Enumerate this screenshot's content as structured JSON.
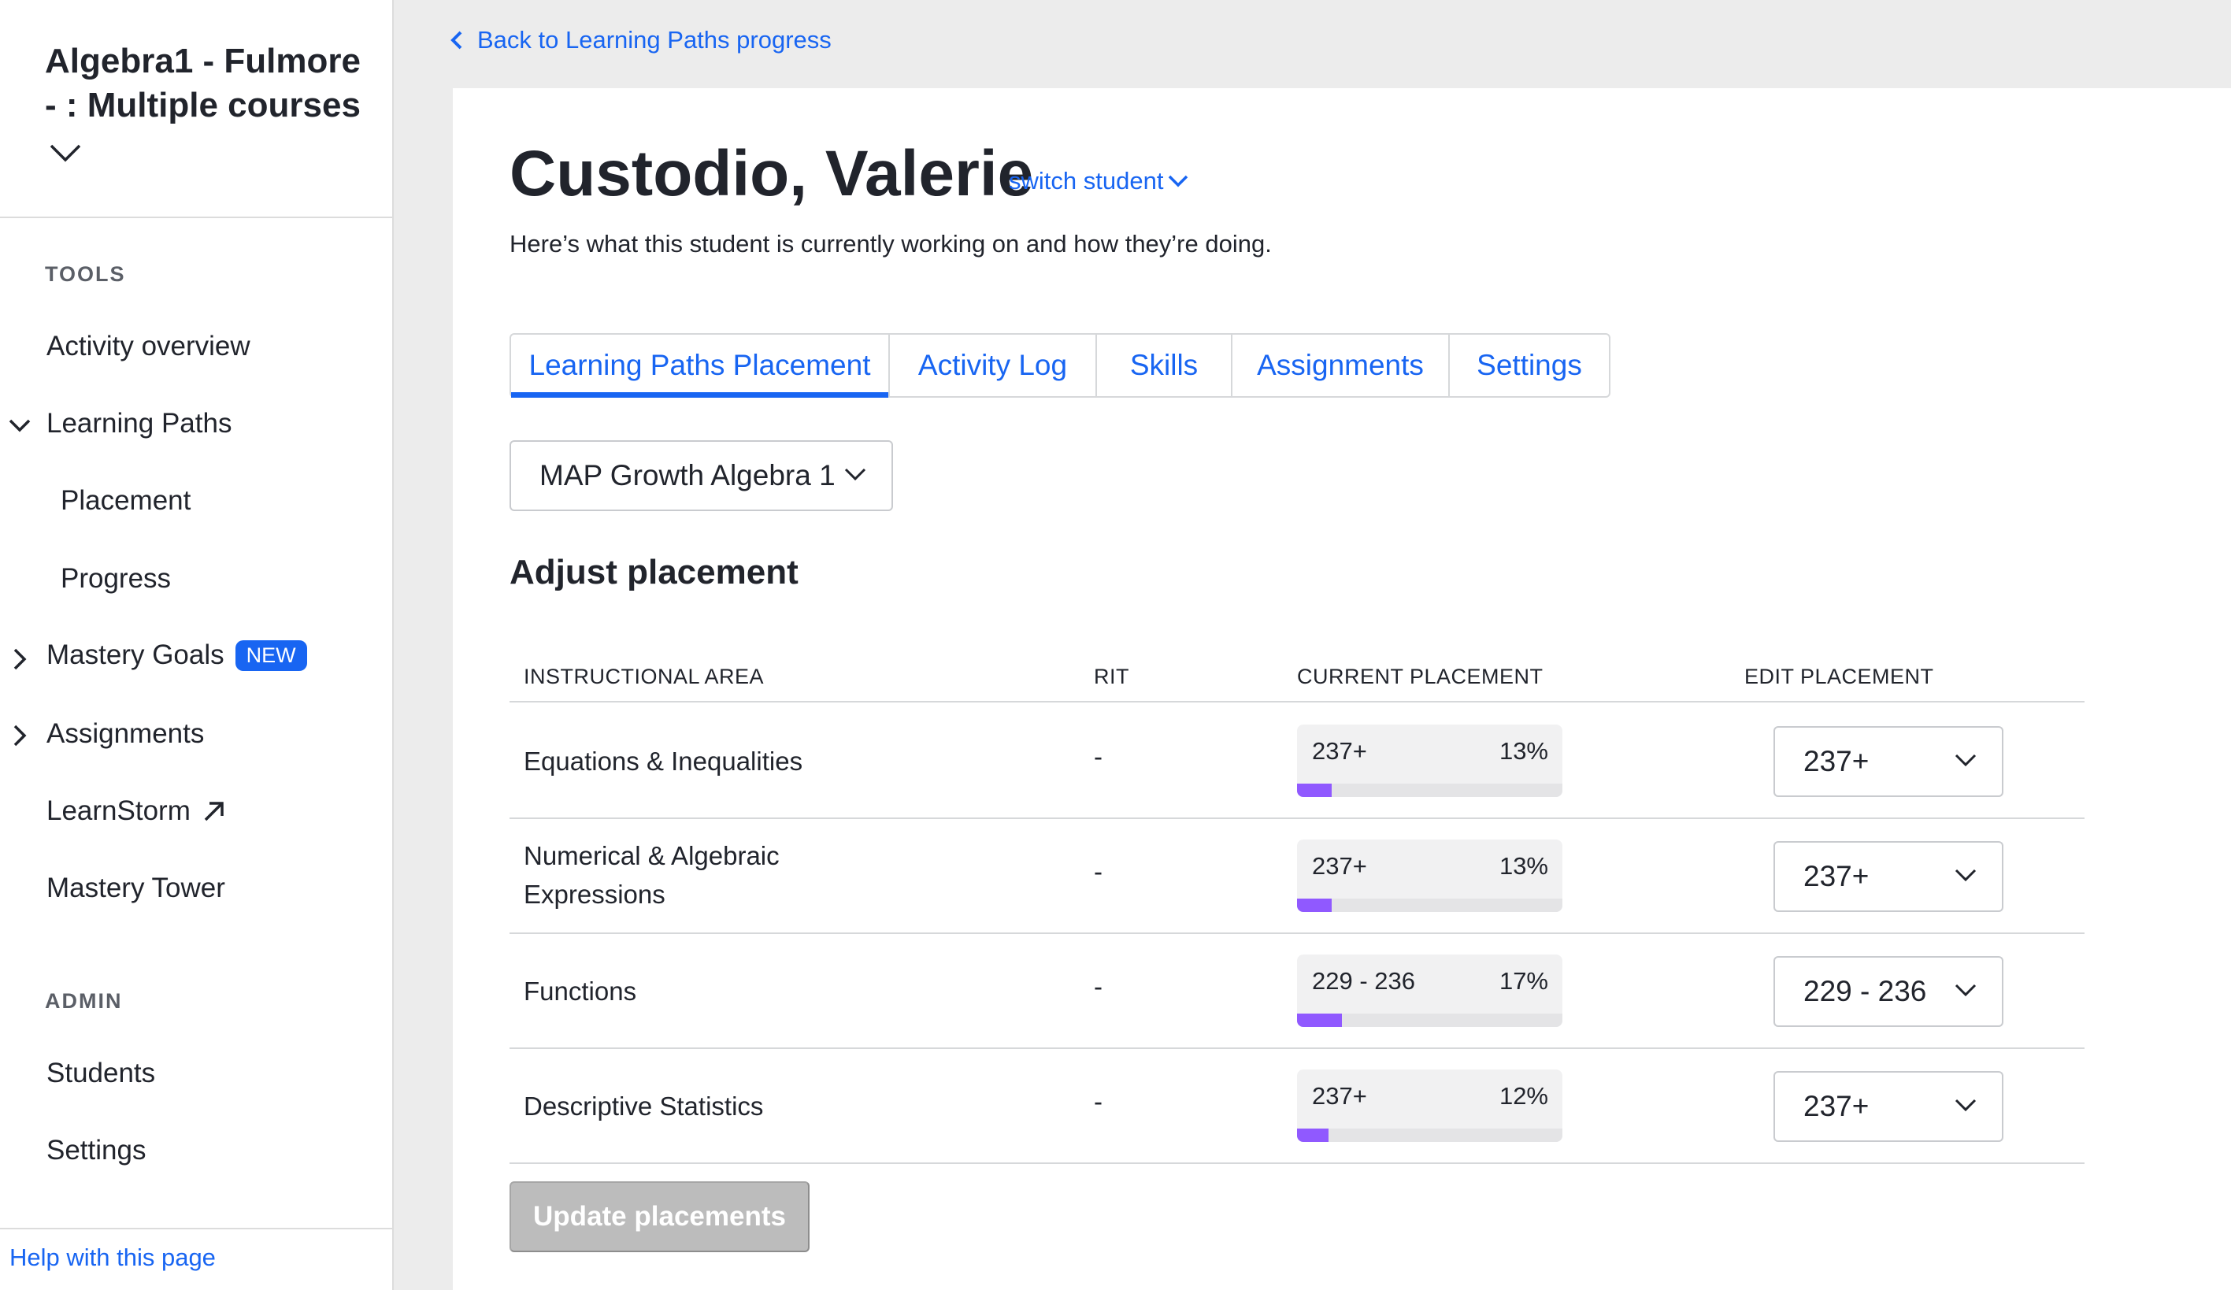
{
  "sidebar": {
    "course_title": "Algebra1 - Fulmore - : Multiple courses",
    "tools_label": "TOOLS",
    "items": [
      {
        "label": "Activity overview"
      },
      {
        "label": "Learning Paths"
      },
      {
        "label": "Placement"
      },
      {
        "label": "Progress"
      },
      {
        "label": "Mastery Goals",
        "badge": "NEW"
      },
      {
        "label": "Assignments"
      },
      {
        "label": "LearnStorm"
      },
      {
        "label": "Mastery Tower"
      }
    ],
    "admin_label": "ADMIN",
    "admin_items": [
      {
        "label": "Students"
      },
      {
        "label": "Settings"
      }
    ],
    "help_link": "Help with this page"
  },
  "back_link": "Back to Learning Paths progress",
  "student": {
    "name": "Custodio, Valerie",
    "switch_label": "switch student",
    "subtitle": "Here’s what this student is currently working on and how they’re doing."
  },
  "tabs": [
    {
      "label": "Learning Paths Placement",
      "active": true
    },
    {
      "label": "Activity Log"
    },
    {
      "label": "Skills"
    },
    {
      "label": "Assignments"
    },
    {
      "label": "Settings"
    }
  ],
  "course_select": {
    "value": "MAP Growth Algebra 1"
  },
  "adjust_heading": "Adjust placement",
  "table": {
    "headers": [
      "INSTRUCTIONAL AREA",
      "RIT",
      "CURRENT PLACEMENT",
      "EDIT PLACEMENT"
    ],
    "rows": [
      {
        "area": "Equations & Inequalities",
        "rit": "-",
        "placement": "237+",
        "percent": "13%",
        "progress": 0.13,
        "edit": "237+"
      },
      {
        "area": "Numerical & Algebraic Expressions",
        "rit": "-",
        "placement": "237+",
        "percent": "13%",
        "progress": 0.13,
        "edit": "237+"
      },
      {
        "area": "Functions",
        "rit": "-",
        "placement": "229 - 236",
        "percent": "17%",
        "progress": 0.17,
        "edit": "229 - 236"
      },
      {
        "area": "Descriptive Statistics",
        "rit": "-",
        "placement": "237+",
        "percent": "12%",
        "progress": 0.12,
        "edit": "237+"
      }
    ]
  },
  "update_button": "Update placements",
  "colors": {
    "link_blue": "#1865f2",
    "progress_purple": "#9059ff",
    "disabled_button": "#bcbcbc"
  }
}
